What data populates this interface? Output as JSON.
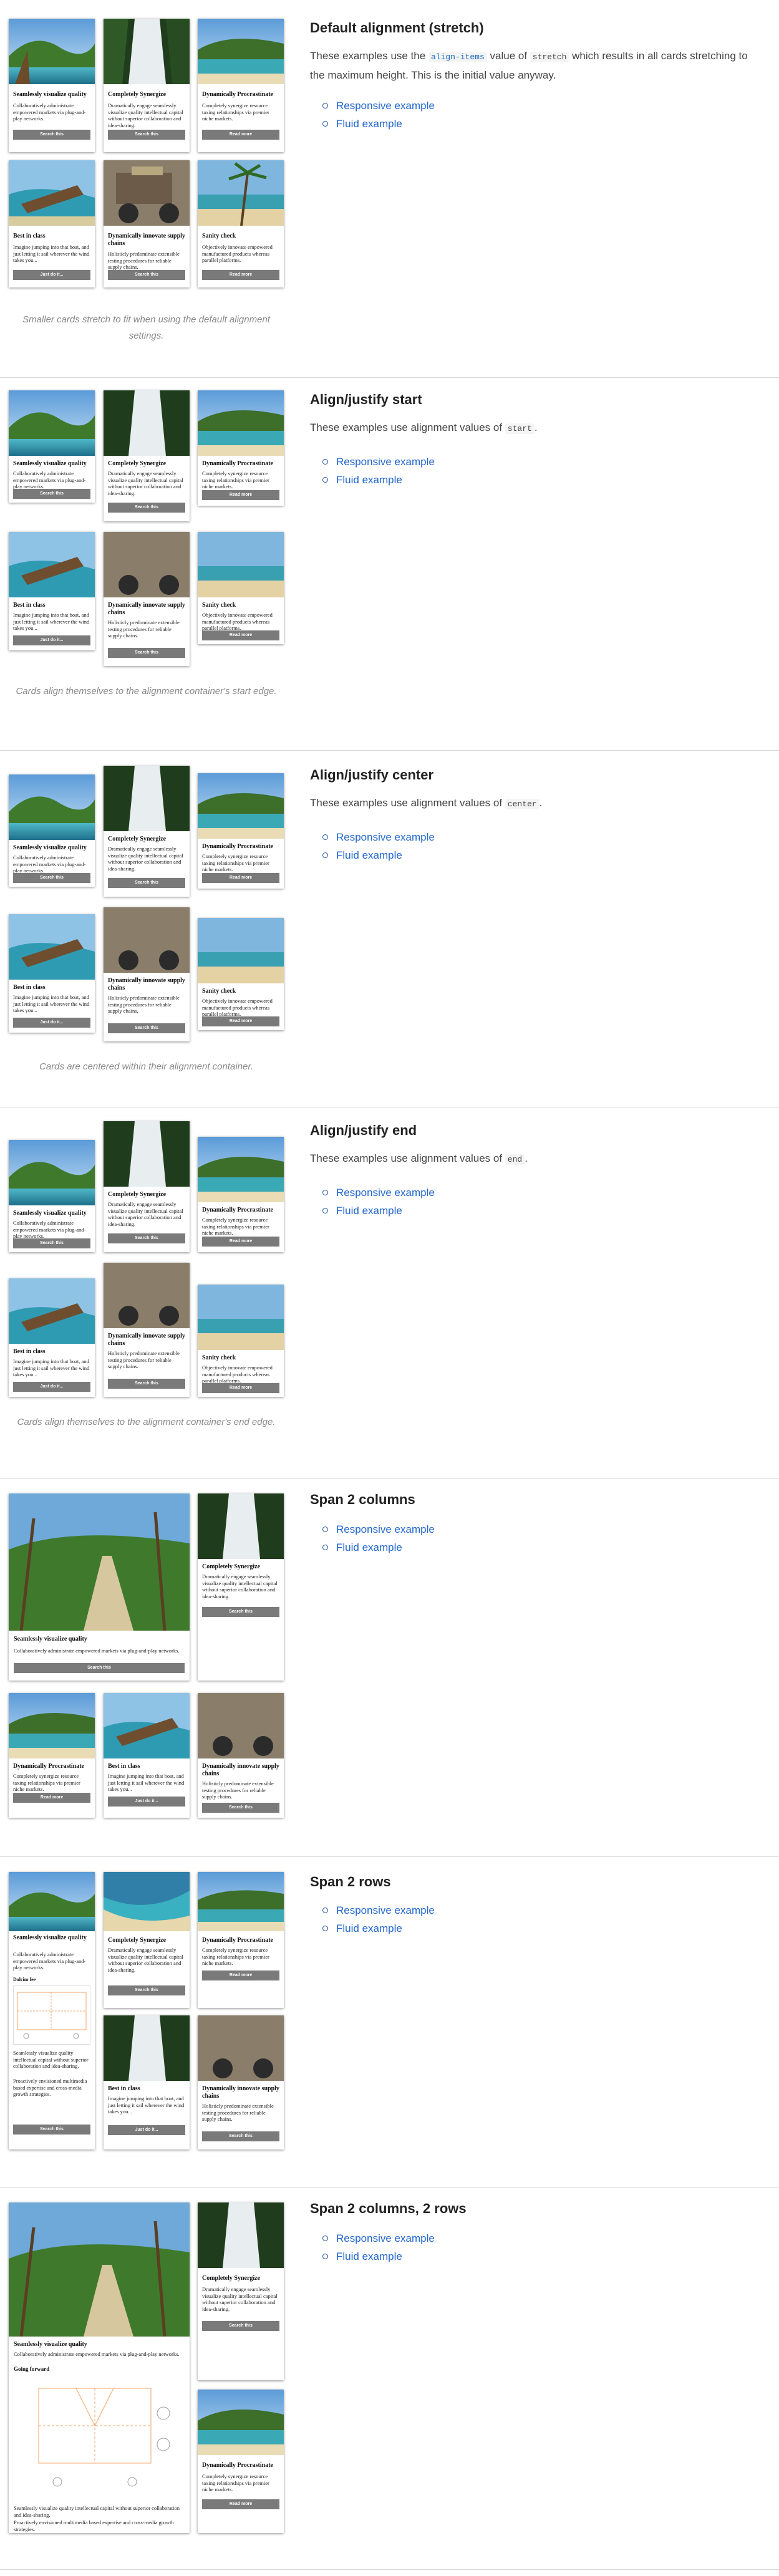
{
  "sections": [
    {
      "title": "Default alignment (stretch)",
      "desc_pre": "These examples use the",
      "desc_code1": "align-items",
      "desc_mid": "value of",
      "desc_code2": "stretch",
      "desc_post": "which results in all cards stretching to the maximum height. This is the initial value anyway.",
      "link1": "Responsive example",
      "link2": "Fluid example",
      "caption": "Smaller cards stretch to fit when using the default alignment settings."
    },
    {
      "title": "Align/justify start",
      "desc_pre": "These examples use alignment values of",
      "desc_code": "start",
      "desc_post": ".",
      "link1": "Responsive example",
      "link2": "Fluid example",
      "caption": "Cards align themselves to the alignment container's start edge."
    },
    {
      "title": "Align/justify center",
      "desc_pre": "These examples use alignment values of",
      "desc_code": "center",
      "desc_post": ".",
      "link1": "Responsive example",
      "link2": "Fluid example",
      "caption": "Cards are centered within their alignment container."
    },
    {
      "title": "Align/justify end",
      "desc_pre": "These examples use alignment values of",
      "desc_code": "end",
      "desc_post": ".",
      "link1": "Responsive example",
      "link2": "Fluid example",
      "caption": "Cards align themselves to the alignment container's end edge."
    },
    {
      "title": "Span 2 columns",
      "link1": "Responsive example",
      "link2": "Fluid example"
    },
    {
      "title": "Span 2 rows",
      "link1": "Responsive example",
      "link2": "Fluid example"
    },
    {
      "title": "Span 2 columns, 2 rows",
      "link1": "Responsive example",
      "link2": "Fluid example"
    }
  ],
  "cards": {
    "c1": {
      "title": "Seamlessly visualize quality",
      "body": "Collaboratively administrate empowered markets via plug-and-play networks.",
      "button": "Search this"
    },
    "c2": {
      "title": "Completely Synergize",
      "body": "Dramatically engage seamlessly visualize quality intellectual capital without superior collaboration and idea-sharing.",
      "button": "Search this"
    },
    "c3": {
      "title": "Dynamically Procrastinate",
      "body": "Completely synergize resource taxing relationships via premier niche markets.",
      "button": "Read more"
    },
    "c4": {
      "title": "Best in class",
      "body": "Imagine jumping into that boat, and just letting it sail wherever the wind takes you...",
      "button": "Just do it..."
    },
    "c5": {
      "title": "Dynamically innovate supply chains",
      "body": "Holisticly predominate extensible testing procedures for reliable supply chains.",
      "button": "Search this"
    },
    "c6": {
      "title": "Sanity check",
      "body": "Objectively innovate empowered manufactured products whereas parallel platforms.",
      "button": "Read more"
    }
  },
  "extra": {
    "kicker": "Dolcim fee",
    "going_forward": "Going forward",
    "para1": "Seamlessly visualize quality intellectual capital without superior collaboration and idea-sharing.",
    "para2": "Proactively envisioned multimedia based expertise and cross-media growth strategies."
  },
  "colors": {
    "link": "#2266cc",
    "button": "#7a7a7a",
    "code_blue": "#1565c0"
  },
  "icons": [
    "circle-bullet-icon"
  ]
}
